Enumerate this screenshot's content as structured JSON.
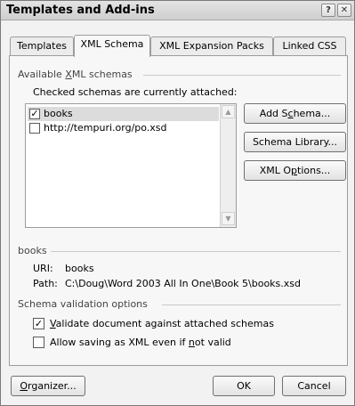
{
  "dialog": {
    "title": "Templates and Add-ins",
    "help_glyph": "?",
    "close_glyph": "✕"
  },
  "tabs": [
    {
      "label": "Templates"
    },
    {
      "label": "XML Schema"
    },
    {
      "label": "XML Expansion Packs"
    },
    {
      "label": "Linked CSS"
    }
  ],
  "available": {
    "group_label_pre": "Available ",
    "group_label_key": "X",
    "group_label_post": "ML schemas",
    "instruction": "Checked schemas are currently attached:",
    "schemas": [
      {
        "name": "books",
        "checked": true,
        "check_glyph": "✓"
      },
      {
        "name": "http://tempuri.org/po.xsd",
        "checked": false,
        "check_glyph": ""
      }
    ],
    "scroll_up_glyph": "▲",
    "scroll_down_glyph": "▼"
  },
  "buttons": {
    "add_schema_pre": "Add S",
    "add_schema_key": "c",
    "add_schema_post": "hema...",
    "schema_library": "Schema Library...",
    "xml_options_pre": "XML O",
    "xml_options_key": "p",
    "xml_options_post": "tions...",
    "organizer_key": "O",
    "organizer_post": "rganizer...",
    "ok": "OK",
    "cancel": "Cancel"
  },
  "details": {
    "group_label": "books",
    "uri_label": "URI:",
    "uri_value": "books",
    "path_label": "Path:",
    "path_value": "C:\\Doug\\Word 2003 All In One\\Book 5\\books.xsd"
  },
  "validation": {
    "group_label": "Schema validation options",
    "validate_key": "V",
    "validate_post": "alidate document against attached schemas",
    "validate_checked": true,
    "validate_check_glyph": "✓",
    "allow_pre": "Allow saving as XML even if ",
    "allow_key": "n",
    "allow_post": "ot valid",
    "allow_checked": false,
    "allow_check_glyph": ""
  }
}
